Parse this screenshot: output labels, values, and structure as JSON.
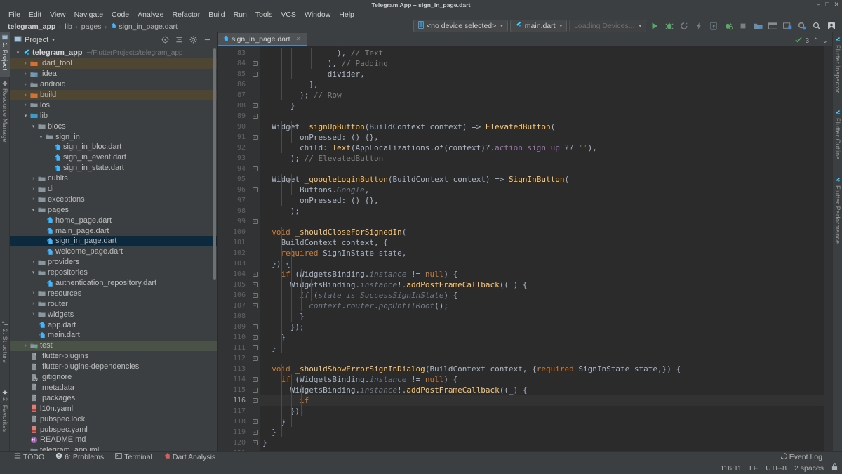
{
  "window": {
    "title": "Telegram App – sign_in_page.dart",
    "minimize": "–",
    "maximize": "□",
    "close": "✕"
  },
  "menubar": {
    "items": [
      "File",
      "Edit",
      "View",
      "Navigate",
      "Code",
      "Analyze",
      "Refactor",
      "Build",
      "Run",
      "Tools",
      "VCS",
      "Window",
      "Help"
    ]
  },
  "breadcrumb": {
    "project": "telegram_app",
    "items": [
      "lib",
      "pages"
    ],
    "file": "sign_in_page.dart",
    "separator": "›"
  },
  "toolbar": {
    "device_selector": "<no device selected>",
    "run_config": "main.dart",
    "devices_status": "Loading Devices...",
    "caret": "▾",
    "icons": [
      "run-icon",
      "debug-icon",
      "profile-icon",
      "hot-reload-icon",
      "hot-restart-icon",
      "open-devtools-icon",
      "stop-icon",
      "project-structure-icon",
      "terminal-icon",
      "device-manager-icon",
      "settings-sync-icon",
      "search-icon",
      "account-icon"
    ]
  },
  "left_rail": {
    "top": [
      "1: Project",
      "Resource Manager"
    ],
    "bottom": [
      "2: Structure",
      "2: Favorites"
    ]
  },
  "right_rail": {
    "items": [
      "Flutter Inspector",
      "Flutter Outline",
      "Flutter Performance"
    ]
  },
  "project_panel": {
    "title": "Project",
    "caret": "▾",
    "actions": [
      "locate-icon",
      "collapse-all-icon",
      "settings-icon",
      "hide-icon"
    ],
    "root": {
      "label": "telegram_app",
      "hint": "~/FlutterProjects/telegram_app"
    },
    "tree": [
      {
        "depth": 0,
        "label": "telegram_app",
        "hint": "~/FlutterProjects/telegram_app",
        "arrow": "▾",
        "icon": "flutter-icon",
        "bold": true,
        "highlight": ""
      },
      {
        "depth": 1,
        "label": ".dart_tool",
        "arrow": "›",
        "icon": "folder-excluded-icon",
        "highlight": "orange"
      },
      {
        "depth": 1,
        "label": ".idea",
        "arrow": "›",
        "icon": "folder-idea-icon",
        "highlight": ""
      },
      {
        "depth": 1,
        "label": "android",
        "arrow": "›",
        "icon": "folder-icon",
        "highlight": ""
      },
      {
        "depth": 1,
        "label": "build",
        "arrow": "›",
        "icon": "folder-excluded-icon",
        "highlight": "orange"
      },
      {
        "depth": 1,
        "label": "ios",
        "arrow": "›",
        "icon": "folder-icon",
        "highlight": ""
      },
      {
        "depth": 1,
        "label": "lib",
        "arrow": "▾",
        "icon": "folder-source-icon",
        "highlight": ""
      },
      {
        "depth": 2,
        "label": "blocs",
        "arrow": "▾",
        "icon": "folder-icon",
        "highlight": ""
      },
      {
        "depth": 3,
        "label": "sign_in",
        "arrow": "▾",
        "icon": "folder-icon",
        "highlight": ""
      },
      {
        "depth": 4,
        "label": "sign_in_bloc.dart",
        "arrow": "",
        "icon": "dart-file-icon",
        "highlight": ""
      },
      {
        "depth": 4,
        "label": "sign_in_event.dart",
        "arrow": "",
        "icon": "dart-file-icon",
        "highlight": ""
      },
      {
        "depth": 4,
        "label": "sign_in_state.dart",
        "arrow": "",
        "icon": "dart-file-icon",
        "highlight": ""
      },
      {
        "depth": 2,
        "label": "cubits",
        "arrow": "›",
        "icon": "folder-icon",
        "highlight": ""
      },
      {
        "depth": 2,
        "label": "di",
        "arrow": "›",
        "icon": "folder-icon",
        "highlight": ""
      },
      {
        "depth": 2,
        "label": "exceptions",
        "arrow": "›",
        "icon": "folder-icon",
        "highlight": ""
      },
      {
        "depth": 2,
        "label": "pages",
        "arrow": "▾",
        "icon": "folder-icon",
        "highlight": ""
      },
      {
        "depth": 3,
        "label": "home_page.dart",
        "arrow": "",
        "icon": "dart-file-icon",
        "highlight": ""
      },
      {
        "depth": 3,
        "label": "main_page.dart",
        "arrow": "",
        "icon": "dart-file-icon",
        "highlight": ""
      },
      {
        "depth": 3,
        "label": "sign_in_page.dart",
        "arrow": "",
        "icon": "dart-file-icon",
        "highlight": "selected"
      },
      {
        "depth": 3,
        "label": "welcome_page.dart",
        "arrow": "",
        "icon": "dart-file-icon",
        "highlight": ""
      },
      {
        "depth": 2,
        "label": "providers",
        "arrow": "›",
        "icon": "folder-icon",
        "highlight": ""
      },
      {
        "depth": 2,
        "label": "repositories",
        "arrow": "▾",
        "icon": "folder-icon",
        "highlight": ""
      },
      {
        "depth": 3,
        "label": "authentication_repository.dart",
        "arrow": "",
        "icon": "dart-file-icon",
        "highlight": ""
      },
      {
        "depth": 2,
        "label": "resources",
        "arrow": "›",
        "icon": "folder-icon",
        "highlight": ""
      },
      {
        "depth": 2,
        "label": "router",
        "arrow": "›",
        "icon": "folder-icon",
        "highlight": ""
      },
      {
        "depth": 2,
        "label": "widgets",
        "arrow": "›",
        "icon": "folder-icon",
        "highlight": ""
      },
      {
        "depth": 2,
        "label": "app.dart",
        "arrow": "",
        "icon": "dart-file-icon",
        "highlight": ""
      },
      {
        "depth": 2,
        "label": "main.dart",
        "arrow": "",
        "icon": "dart-file-icon",
        "highlight": ""
      },
      {
        "depth": 1,
        "label": "test",
        "arrow": "›",
        "icon": "folder-test-icon",
        "highlight": "green"
      },
      {
        "depth": 1,
        "label": ".flutter-plugins",
        "arrow": "",
        "icon": "file-icon",
        "highlight": ""
      },
      {
        "depth": 1,
        "label": ".flutter-plugins-dependencies",
        "arrow": "",
        "icon": "file-icon",
        "highlight": ""
      },
      {
        "depth": 1,
        "label": ".gitignore",
        "arrow": "",
        "icon": "gitignore-icon",
        "highlight": ""
      },
      {
        "depth": 1,
        "label": ".metadata",
        "arrow": "",
        "icon": "file-icon",
        "highlight": ""
      },
      {
        "depth": 1,
        "label": ".packages",
        "arrow": "",
        "icon": "file-icon",
        "highlight": ""
      },
      {
        "depth": 1,
        "label": "l10n.yaml",
        "arrow": "",
        "icon": "yaml-icon",
        "highlight": ""
      },
      {
        "depth": 1,
        "label": "pubspec.lock",
        "arrow": "",
        "icon": "file-icon",
        "highlight": ""
      },
      {
        "depth": 1,
        "label": "pubspec.yaml",
        "arrow": "",
        "icon": "yaml-icon",
        "highlight": ""
      },
      {
        "depth": 1,
        "label": "README.md",
        "arrow": "",
        "icon": "markdown-icon",
        "highlight": ""
      },
      {
        "depth": 1,
        "label": "telegram_app.iml",
        "arrow": "",
        "icon": "module-icon",
        "highlight": ""
      }
    ]
  },
  "editor": {
    "tab": {
      "label": "sign_in_page.dart",
      "icon": "dart-file-icon",
      "close": "✕"
    },
    "inspections": {
      "count": "3",
      "up": "⌃",
      "down": "⌄",
      "icon": "checkmark-icon"
    },
    "first_line": 83,
    "cursor_line": 116,
    "lines": [
      {
        "n": 83,
        "html": "                ), <span class='cm'>// Text</span>"
      },
      {
        "n": 84,
        "html": "              ), <span class='cm'>// Padding</span>"
      },
      {
        "n": 85,
        "html": "              divider,"
      },
      {
        "n": 86,
        "html": "          ],"
      },
      {
        "n": 87,
        "html": "        ); <span class='cm'>// Row</span>"
      },
      {
        "n": 88,
        "html": "      }"
      },
      {
        "n": 89,
        "html": ""
      },
      {
        "n": 90,
        "html": "  <span class='ty'>Widget</span> <span class='fn'>_signUpButton</span>(<span class='ty'>BuildContext</span> context) =&gt; <span class='fn'>ElevatedButton</span>("
      },
      {
        "n": 91,
        "html": "        onPressed: () {},"
      },
      {
        "n": 92,
        "html": "        child: <span class='fn'>Text</span>(<span class='ty'>AppLocalizations</span>.<span class='it'>of</span>(context)?.<span class='fd'>action_sign_up</span> ?? <span class='st'>''</span>),"
      },
      {
        "n": 93,
        "html": "      ); <span class='cm'>// ElevatedButton</span>"
      },
      {
        "n": 94,
        "html": ""
      },
      {
        "n": 95,
        "html": "  <span class='ty'>Widget</span> <span class='fn'>_googleLoginButton</span>(<span class='ty'>BuildContext</span> context) =&gt; <span class='fn'>SignInButton</span>("
      },
      {
        "n": 96,
        "html": "        <span class='ty'>Buttons</span>.<span class='dim'>Google</span>,"
      },
      {
        "n": 97,
        "html": "        onPressed: () {},"
      },
      {
        "n": 98,
        "html": "      );"
      },
      {
        "n": 99,
        "html": ""
      },
      {
        "n": 100,
        "html": "  <span class='k'>void</span> <span class='fn'>_shouldCloseForSignedIn</span>("
      },
      {
        "n": 101,
        "html": "    <span class='ty'>BuildContext</span> context, {"
      },
      {
        "n": 102,
        "html": "    <span class='k'>required</span> <span class='ty'>SignInState</span> state,"
      },
      {
        "n": 103,
        "html": "  }) {"
      },
      {
        "n": 104,
        "html": "    <span class='k'>if</span> (<span class='ty'>WidgetsBinding</span>.<span class='dim'>instance</span> != <span class='k'>null</span>) {"
      },
      {
        "n": 105,
        "html": "      <span class='ty'>WidgetsBinding</span>.<span class='dim'>instance</span>!.<span class='fn'>addPostFrameCallback</span>((_) {"
      },
      {
        "n": 106,
        "html": "        <span class='dim'>if</span> (<span class='dim'>state</span> <span class='dim'>is</span> <span class='dim'>SuccessSignInState</span>) {"
      },
      {
        "n": 107,
        "html": "          <span class='dim'>context</span>.<span class='dim'>router</span>.<span class='dim'>popUntilRoot</span>();"
      },
      {
        "n": 108,
        "html": "        }"
      },
      {
        "n": 109,
        "html": "      });"
      },
      {
        "n": 110,
        "html": "    }"
      },
      {
        "n": 111,
        "html": "  }"
      },
      {
        "n": 112,
        "html": ""
      },
      {
        "n": 113,
        "html": "  <span class='k'>void</span> <span class='fn'>_shouldShowErrorSignInDialog</span>(<span class='ty'>BuildContext</span> context, {<span class='k'>required</span> <span class='ty'>SignInState</span> state,}) {"
      },
      {
        "n": 114,
        "html": "    <span class='k'>if</span> (<span class='ty'>WidgetsBinding</span>.<span class='dim'>instance</span> != <span class='k'>null</span>) {"
      },
      {
        "n": 115,
        "html": "      <span class='ty'>WidgetsBinding</span>.<span class='dim'>instance</span>!.<span class='fn'>addPostFrameCallback</span>((_) {"
      },
      {
        "n": 116,
        "html": "        <span class='k'>if</span> <span class='caret-bar'></span>"
      },
      {
        "n": 117,
        "html": "      });"
      },
      {
        "n": 118,
        "html": "    }"
      },
      {
        "n": 119,
        "html": "  }"
      },
      {
        "n": 120,
        "html": "}"
      },
      {
        "n": 121,
        "html": ""
      }
    ]
  },
  "bottom_tools": [
    {
      "label": "TODO",
      "icon": "todo-icon"
    },
    {
      "label": "6: Problems",
      "icon": "problems-icon"
    },
    {
      "label": "Terminal",
      "icon": "terminal-icon"
    },
    {
      "label": "Dart Analysis",
      "icon": "dart-analysis-icon"
    }
  ],
  "status": {
    "event_log": "Event Log",
    "caret_position": "116:11",
    "line_separator": "LF",
    "encoding": "UTF-8",
    "indent": "2 spaces",
    "lock_icon": "read-only-icon"
  },
  "colors": {
    "accent_blue": "#4a88c7",
    "panel_bg": "#3c3f41",
    "editor_bg": "#2b2b2b",
    "gutter_bg": "#313335",
    "selection_blue": "#0d293e",
    "keyword_orange": "#cc7832",
    "function_gold": "#ffc66d",
    "string_green": "#6a8759",
    "comment_gray": "#808080",
    "field_purple": "#9876aa"
  }
}
